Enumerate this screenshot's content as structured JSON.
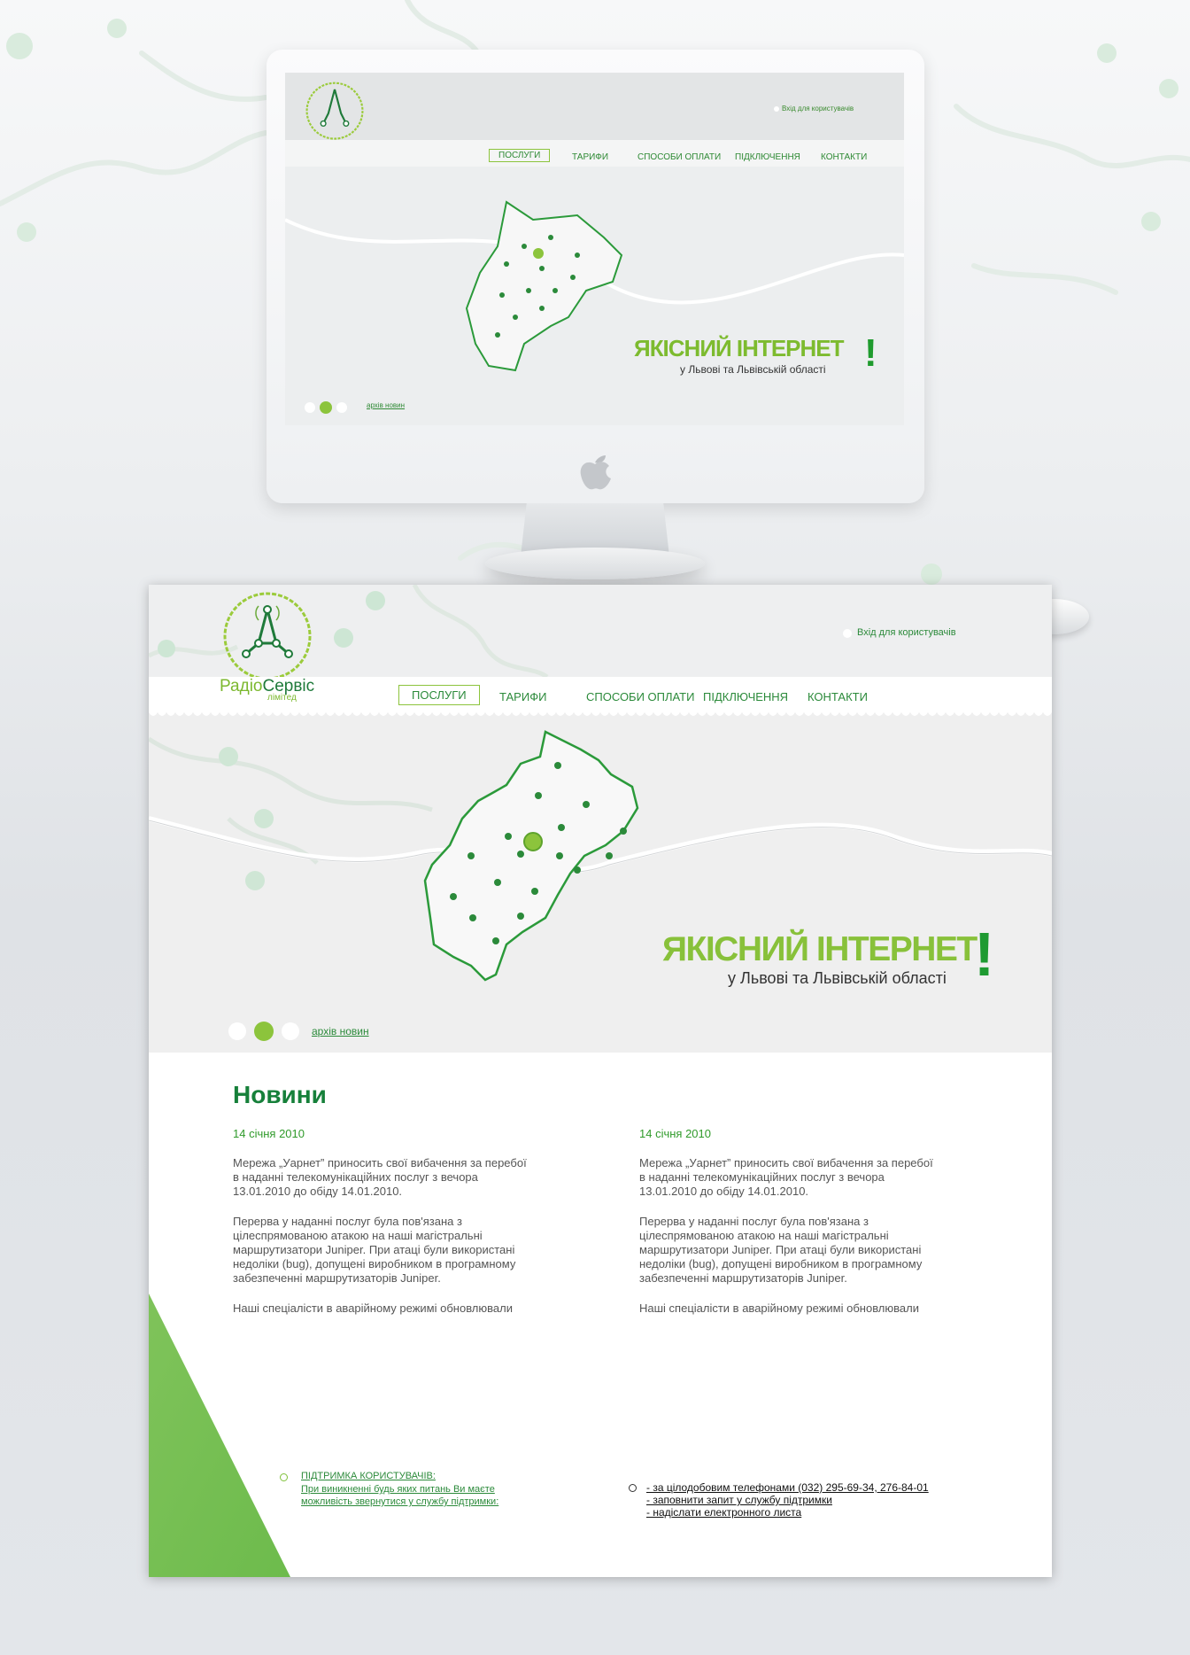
{
  "brand": {
    "name_part1": "Радіо",
    "name_part2": "Сервіс",
    "suffix": "лімітед",
    "green": "#2b8a3a",
    "lime": "#88c13a",
    "accent": "#1e9a31"
  },
  "header": {
    "login_link": "Вхід для користувачів"
  },
  "nav": {
    "items": [
      {
        "label": "ПОСЛУГИ",
        "active": true
      },
      {
        "label": "ТАРИФИ",
        "active": false
      },
      {
        "label": "СПОСОБИ ОПЛАТИ",
        "active": false
      },
      {
        "label": "ПІДКЛЮЧЕННЯ",
        "active": false
      },
      {
        "label": "КОНТАКТИ",
        "active": false
      }
    ]
  },
  "hero": {
    "headline": "ЯКІСНИЙ ІНТЕРНЕТ",
    "exclamation": "!",
    "subheadline": "у Львові та Львівській області",
    "archive_link": "архів новин",
    "active_slide": 2,
    "slide_count": 3
  },
  "news": {
    "title": "Новини",
    "items": [
      {
        "date": "14 січня 2010",
        "p1": "Мережа „Уарнет” приносить свої  вибачення за перебої\nв наданні телекомунікаційних послуг з вечора\n13.01.2010 до обіду 14.01.2010.",
        "p2": "Перерва у наданні послуг була  пов'язана з\nцілеспрямованою атакою на наші магістральні\nмаршрутизатори Juniper. При атаці були використані\nнедоліки (bug),  допущені виробником в програмному\nзабезпеченні маршрутизаторів Juniper.",
        "p3": "Наші спеціалісти в аварійному режимі обновлювали"
      },
      {
        "date": "14 січня 2010",
        "p1": "Мережа „Уарнет” приносить свої  вибачення за перебої\nв наданні телекомунікаційних послуг з вечора\n13.01.2010 до обіду 14.01.2010.",
        "p2": "Перерва у наданні послуг була  пов'язана з\nцілеспрямованою атакою на наші магістральні\nмаршрутизатори Juniper. При атаці були використані\nнедоліки (bug),  допущені виробником в програмному\nзабезпеченні маршрутизаторів Juniper.",
        "p3": "Наші спеціалісти в аварійному режимі обновлювали"
      }
    ]
  },
  "footer": {
    "support_title": "ПІДТРИМКА КОРИСТУВАЧІВ:",
    "support_text": "При виникненні будь яких питань Ви маєте можливість звернутися у службу підтримки:",
    "contacts": [
      "- за цілодобовим телефонами (032) 295-69-34, 276-84-01",
      "- заповнити запит у службу підтримки",
      "- надіслати електронного листа"
    ]
  },
  "icons": [
    "antenna-logo-icon",
    "apple-logo-icon",
    "slider-dot-icon",
    "map-region-icon"
  ]
}
